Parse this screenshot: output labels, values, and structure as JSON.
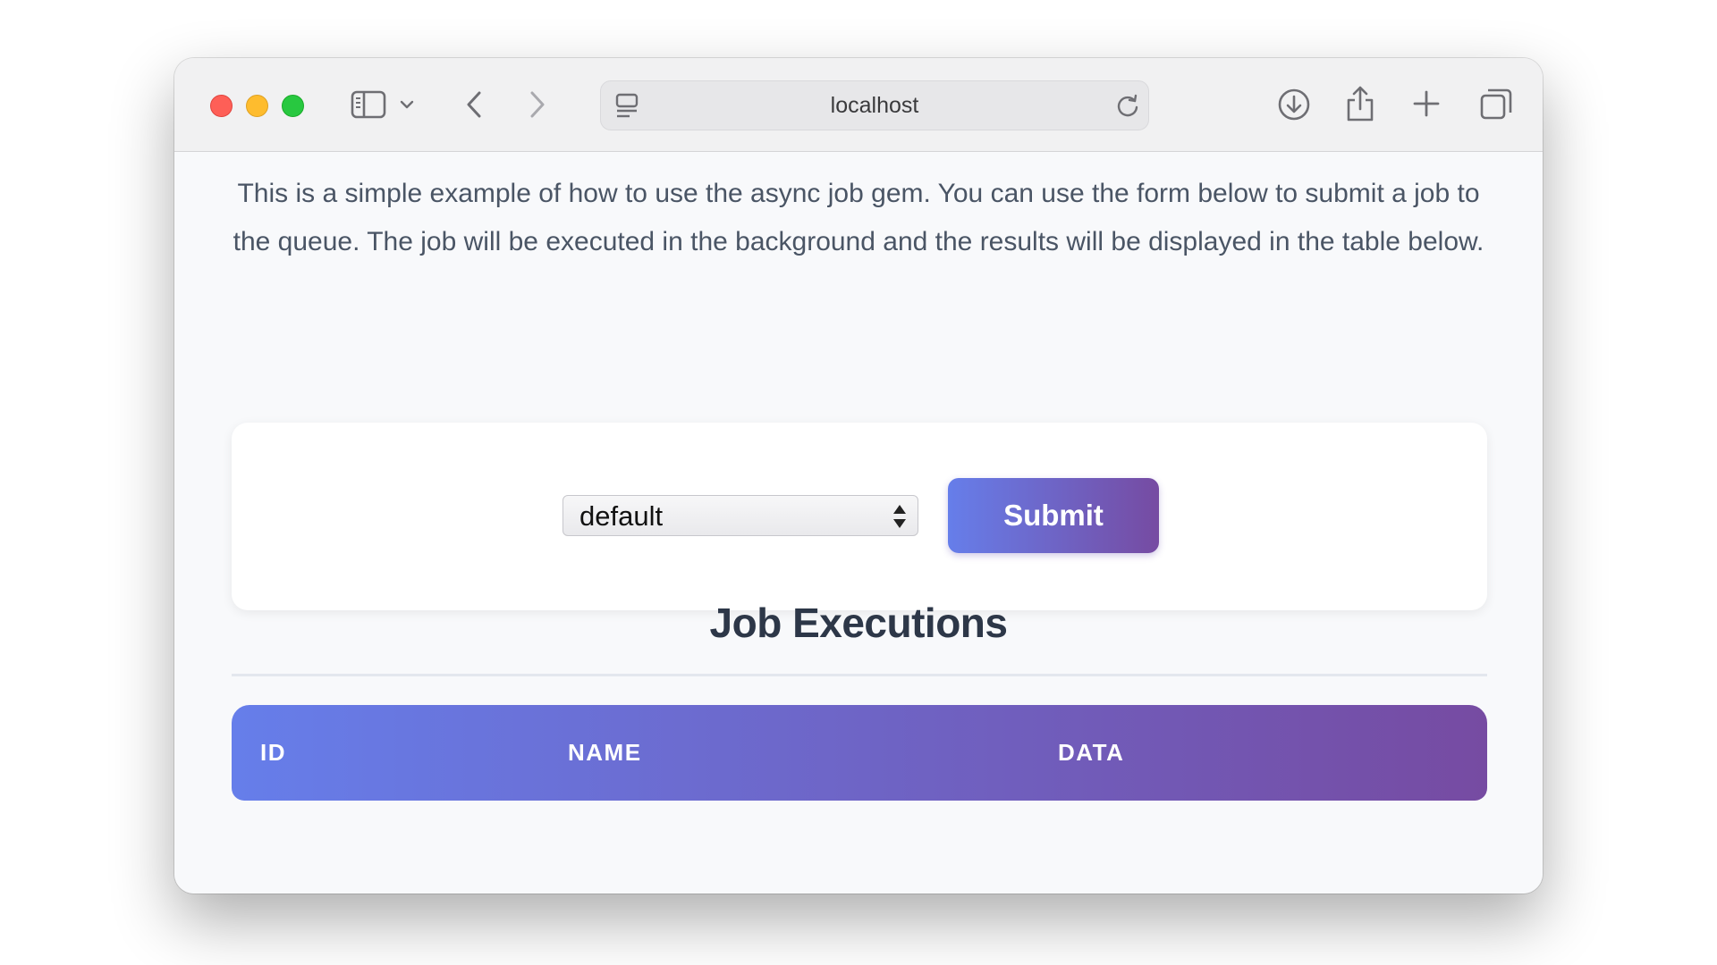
{
  "browser": {
    "url": "localhost"
  },
  "page": {
    "intro": "This is a simple example of how to use the async job gem. You can use the form below to submit a job to the queue. The job will be executed in the background and the results will be displayed in the table below.",
    "form": {
      "queue_select_value": "default",
      "submit_label": "Submit"
    },
    "section_title": "Job Executions",
    "table": {
      "columns": [
        "ID",
        "NAME",
        "DATA"
      ]
    }
  },
  "colors": {
    "gradient_start": "#667eea",
    "gradient_end": "#764ba2",
    "traffic_red": "#fe5f57",
    "traffic_yellow": "#febc2e",
    "traffic_green": "#28c840"
  }
}
